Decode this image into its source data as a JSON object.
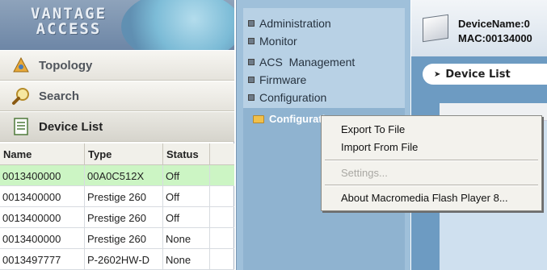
{
  "app": {
    "logo_text_line1": "VANTAGE",
    "logo_text_line2": "ACCESS"
  },
  "nav": {
    "items": [
      {
        "label": "Topology",
        "icon": "topology-icon"
      },
      {
        "label": "Search",
        "icon": "search-icon"
      },
      {
        "label": "Device List",
        "icon": "device-list-icon"
      }
    ]
  },
  "device_table": {
    "columns": [
      "Name",
      "Type",
      "Status"
    ],
    "rows": [
      {
        "name": "0013400000",
        "type": "00A0C512X",
        "status": "Off",
        "selected": true
      },
      {
        "name": "0013400000",
        "type": "Prestige 260",
        "status": "Off"
      },
      {
        "name": "0013400000",
        "type": "Prestige 260",
        "status": "Off"
      },
      {
        "name": "0013400000",
        "type": "Prestige 260",
        "status": "None"
      },
      {
        "name": "0013497777",
        "type": "P-2602HW-D",
        "status": "None"
      }
    ]
  },
  "menu": {
    "items": [
      "Administration",
      "Monitor",
      "ACS  Management",
      "Firmware",
      "Configuration"
    ],
    "submenu_label": "Configuration"
  },
  "device_header": {
    "device_name": "DeviceName:0",
    "mac": "MAC:00134000"
  },
  "tab": {
    "label": "Device List"
  },
  "context_menu": {
    "items": [
      "Export To File",
      "Import From File",
      "Settings...",
      "About Macromedia Flash Player 8..."
    ]
  },
  "colors": {
    "selected_row": "#ccf5c4",
    "menu_panel": "#9fc0da",
    "right_bg": "#6d9bc2"
  }
}
